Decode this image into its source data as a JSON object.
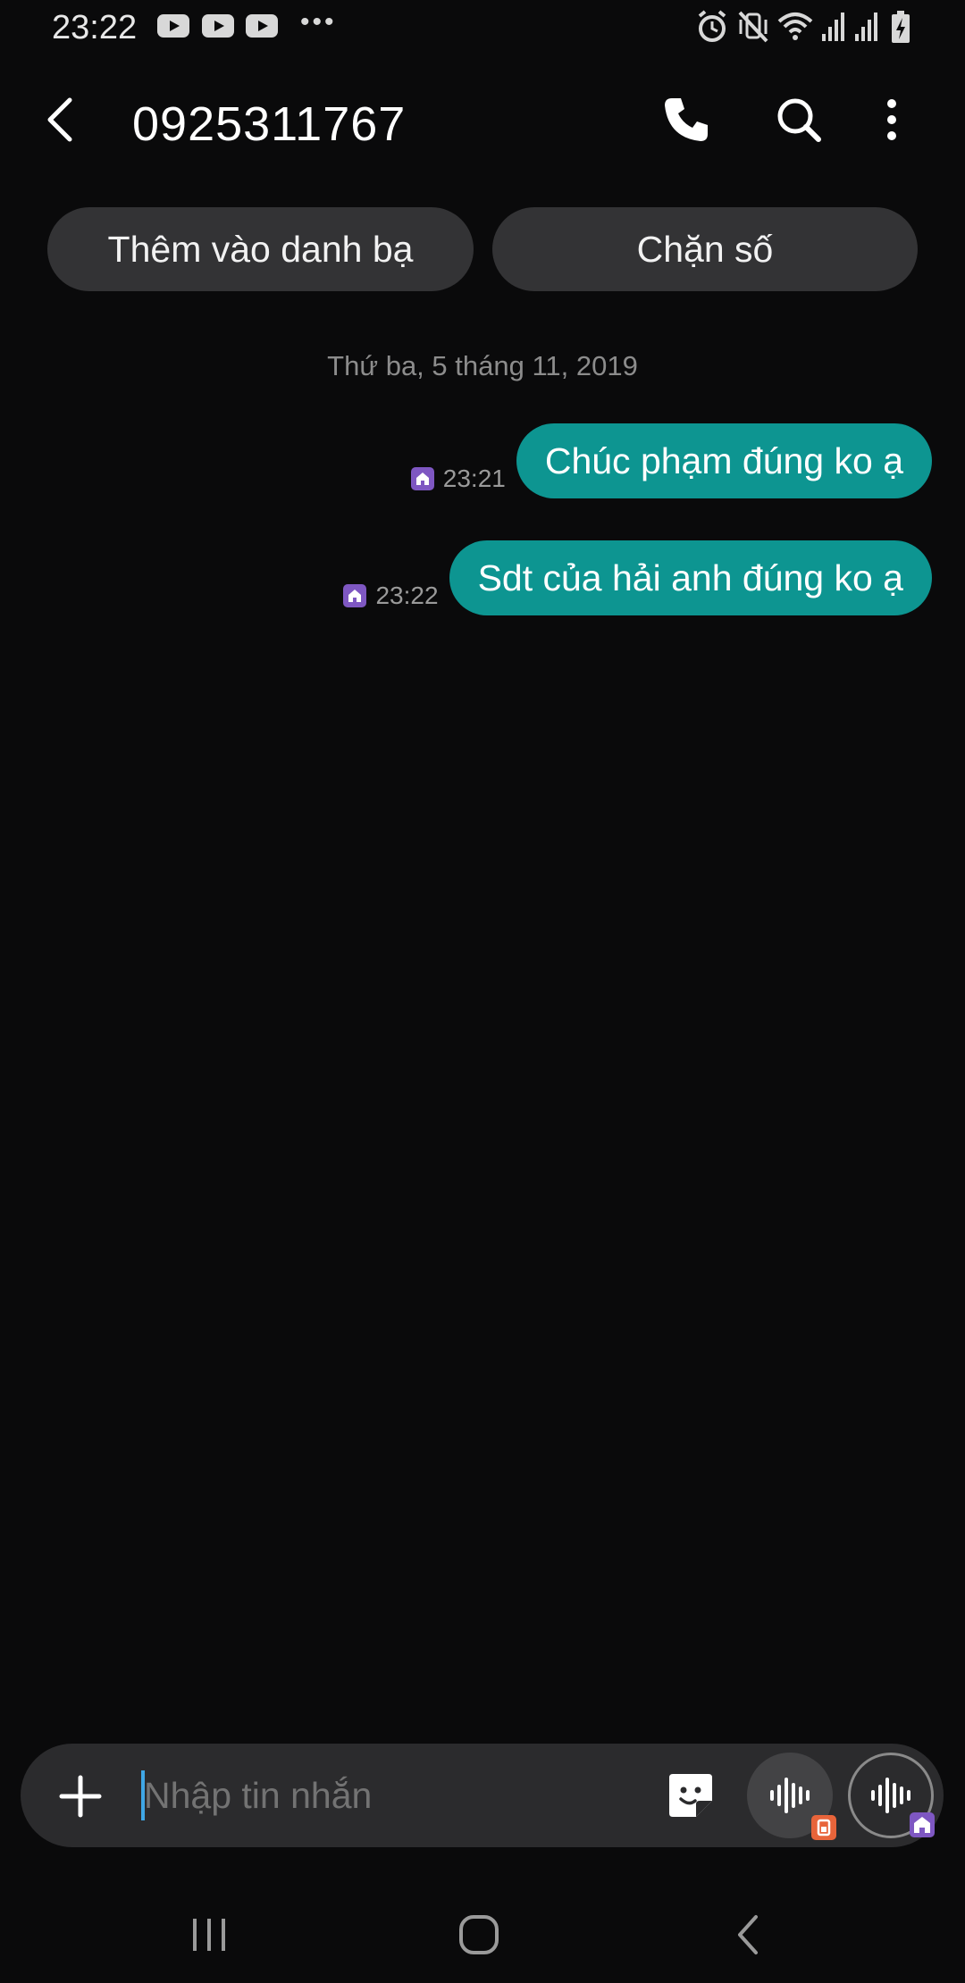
{
  "status_bar": {
    "time": "23:22",
    "icons": [
      "youtube-icon",
      "youtube-icon",
      "youtube-icon",
      "more-dots-icon",
      "alarm-icon",
      "vibrate-mute-icon",
      "wifi-icon",
      "signal-icon",
      "signal-icon",
      "battery-charging-icon"
    ]
  },
  "header": {
    "title": "0925311767",
    "back_icon": "chevron-left-icon",
    "call_icon": "phone-icon",
    "search_icon": "search-icon",
    "more_icon": "more-vertical-icon"
  },
  "actions": {
    "add_contact": "Thêm vào danh bạ",
    "block_number": "Chặn số"
  },
  "conversation": {
    "date": "Thứ ba, 5 tháng 11, 2019",
    "messages": [
      {
        "time": "23:21",
        "text": "Chúc phạm đúng ko ạ",
        "sim_icon": "sim-home-icon"
      },
      {
        "time": "23:22",
        "text": "Sdt của hải anh đúng ko ạ",
        "sim_icon": "sim-home-icon"
      }
    ]
  },
  "composer": {
    "placeholder": "Nhập tin nhắn",
    "value": "",
    "attach_icon": "plus-icon",
    "sticker_icon": "sticker-icon",
    "voice_buttons": [
      "voice-record-icon",
      "voice-record-icon"
    ]
  },
  "nav": {
    "icons": [
      "recent-apps-icon",
      "home-icon",
      "back-icon"
    ]
  },
  "colors": {
    "background": "#0a0a0b",
    "bubble": "#0d9591",
    "pill": "#333335",
    "sim_badge": "#7e57c2",
    "sim_badge_alt": "#e8643a",
    "caret": "#3fa7e6"
  }
}
